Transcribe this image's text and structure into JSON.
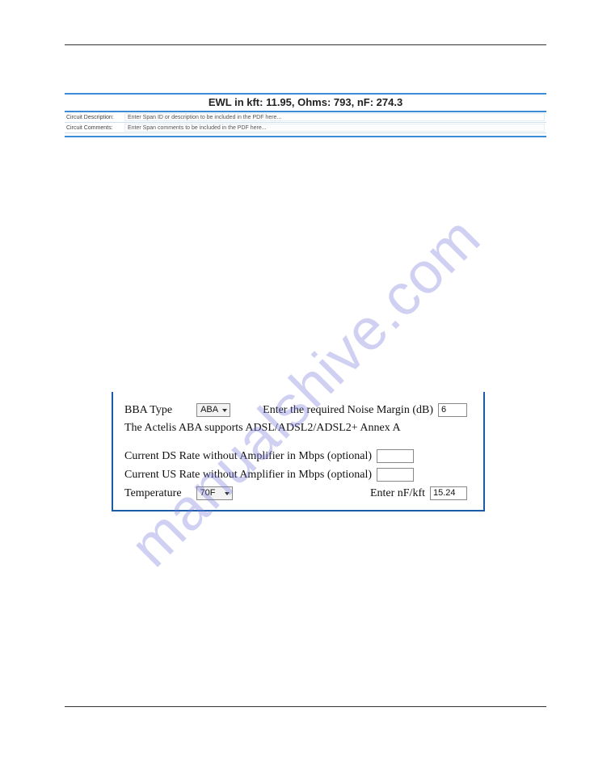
{
  "watermark": "manualshive.com",
  "summary": {
    "title": "EWL in kft: 11.95, Ohms: 793, nF: 274.3",
    "desc_label": "Circuit Description:",
    "desc_value": "Enter Span ID or description to be included in the PDF here...",
    "comm_label": "Circuit Comments:",
    "comm_value": "Enter Span comments to be included in the PDF here..."
  },
  "form": {
    "bba_label": "BBA Type",
    "bba_value": "ABA",
    "noise_label": "Enter the required Noise Margin (dB)",
    "noise_value": "6",
    "support_note": "The Actelis ABA supports ADSL/ADSL2/ADSL2+ Annex A",
    "ds_label": "Current DS Rate without Amplifier in Mbps (optional)",
    "ds_value": "",
    "us_label": "Current US Rate without Amplifier in Mbps (optional)",
    "us_value": "",
    "temp_label": "Temperature",
    "temp_value": "70F",
    "nfkft_label": "Enter nF/kft",
    "nfkft_value": "15.24"
  }
}
